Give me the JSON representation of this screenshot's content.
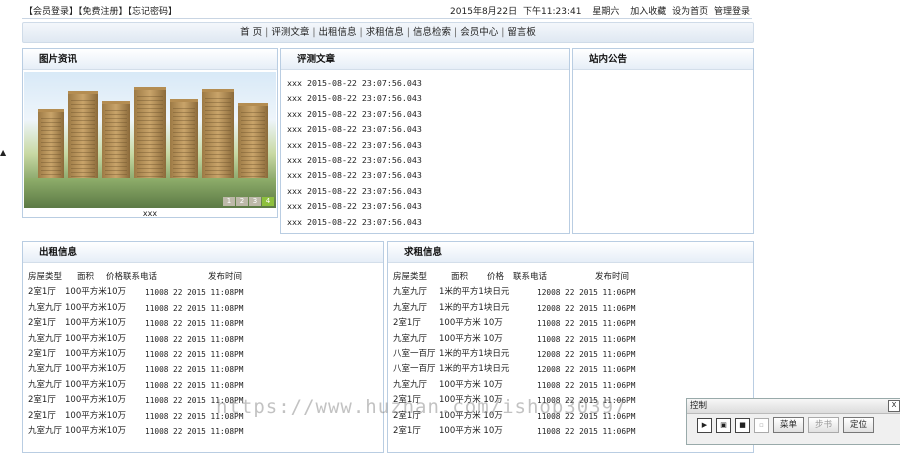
{
  "top": {
    "links": [
      "【会员登录】",
      "【免费注册】",
      "【忘记密码】"
    ],
    "date": "2015年8月22日",
    "time": "下午11:23:41",
    "weekday": "星期六",
    "right_links": [
      "加入收藏",
      "设为首页",
      "管理登录"
    ]
  },
  "nav": [
    "首 页",
    "评测文章",
    "出租信息",
    "求租信息",
    "信息检索",
    "会员中心",
    "留言板"
  ],
  "pictures": {
    "title": "图片资讯",
    "caption": "xxx",
    "pager": [
      "1",
      "2",
      "3",
      "4"
    ]
  },
  "reviews": {
    "title": "评测文章",
    "items": [
      "xxx 2015-08-22 23:07:56.043",
      "xxx 2015-08-22 23:07:56.043",
      "xxx 2015-08-22 23:07:56.043",
      "xxx 2015-08-22 23:07:56.043",
      "xxx 2015-08-22 23:07:56.043",
      "xxx 2015-08-22 23:07:56.043",
      "xxx 2015-08-22 23:07:56.043",
      "xxx 2015-08-22 23:07:56.043",
      "xxx 2015-08-22 23:07:56.043",
      "xxx 2015-08-22 23:07:56.043"
    ]
  },
  "notice": {
    "title": "站内公告"
  },
  "rent": {
    "title": "出租信息",
    "headers": [
      "房屋类型",
      "面积",
      "价格联系电话",
      "发布时间"
    ],
    "rows": [
      [
        "2室1厅",
        "100平方米10万",
        "11008",
        "22 2015 11:08PM"
      ],
      [
        "九室九厅",
        "100平方米10万",
        "11008",
        "22 2015 11:08PM"
      ],
      [
        "2室1厅",
        "100平方米10万",
        "11008",
        "22 2015 11:08PM"
      ],
      [
        "九室九厅",
        "100平方米10万",
        "11008",
        "22 2015 11:08PM"
      ],
      [
        "2室1厅",
        "100平方米10万",
        "11008",
        "22 2015 11:08PM"
      ],
      [
        "九室九厅",
        "100平方米10万",
        "11008",
        "22 2015 11:08PM"
      ],
      [
        "九室九厅",
        "100平方米10万",
        "11008",
        "22 2015 11:08PM"
      ],
      [
        "2室1厅",
        "100平方米10万",
        "11008",
        "22 2015 11:08PM"
      ],
      [
        "2室1厅",
        "100平方米10万",
        "11008",
        "22 2015 11:08PM"
      ],
      [
        "九室九厅",
        "100平方米10万",
        "11008",
        "22 2015 11:08PM"
      ]
    ]
  },
  "wanted": {
    "title": "求租信息",
    "headers": [
      "房屋类型",
      "面积",
      "价格",
      "联系电话",
      "发布时间"
    ],
    "rows": [
      [
        "九室九厅",
        "1米的平方1块日元",
        "12008",
        "22 2015 11:06PM"
      ],
      [
        "九室九厅",
        "1米的平方1块日元",
        "12008",
        "22 2015 11:06PM"
      ],
      [
        "2室1厅",
        "100平方米 10万",
        "11008",
        "22 2015 11:06PM"
      ],
      [
        "九室九厅",
        "100平方米 10万",
        "11008",
        "22 2015 11:06PM"
      ],
      [
        "八室一百厅",
        "1米的平方1块日元",
        "12008",
        "22 2015 11:06PM"
      ],
      [
        "八室一百厅",
        "1米的平方1块日元",
        "12008",
        "22 2015 11:06PM"
      ],
      [
        "九室九厅",
        "100平方米 10万",
        "11008",
        "22 2015 11:06PM"
      ],
      [
        "2室1厅",
        "100平方米 10万",
        "11008",
        "22 2015 11:06PM"
      ],
      [
        "2室1厅",
        "100平方米 10万",
        "11008",
        "22 2015 11:06PM"
      ],
      [
        "2室1厅",
        "100平方米 10万",
        "11008",
        "22 2015 11:06PM"
      ]
    ]
  },
  "watermark": "https://www.huzhan.com/ishop30397",
  "control": {
    "title": "控制",
    "close": "X",
    "buttons": [
      "菜单",
      "步书",
      "定位"
    ]
  }
}
